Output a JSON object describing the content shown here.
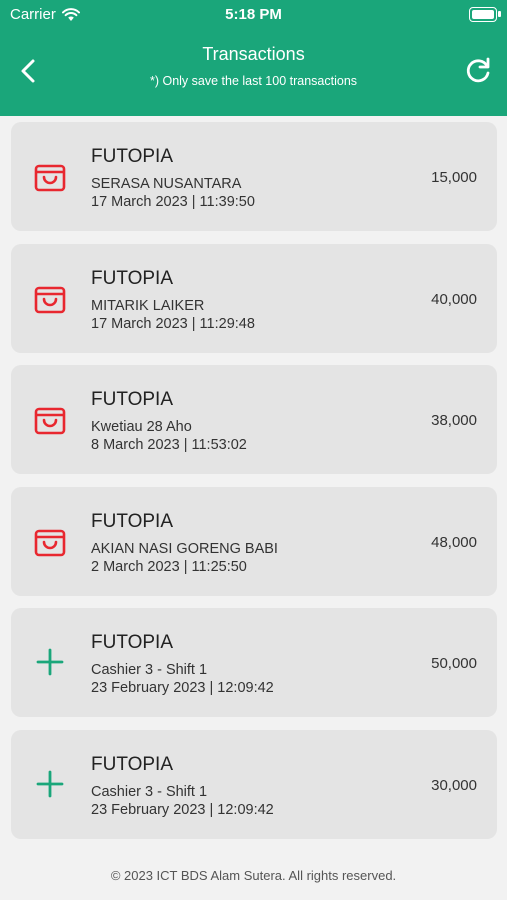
{
  "status_bar": {
    "carrier": "Carrier",
    "time": "5:18 PM"
  },
  "nav": {
    "title": "Transactions",
    "subtitle": "*) Only save the last 100 transactions",
    "back_icon": "chevron-left-icon",
    "refresh_icon": "refresh-icon"
  },
  "colors": {
    "header": "#1aa67a",
    "purchase_icon": "#e8272f",
    "topup_icon": "#1aa67a",
    "card": "#e4e4e4"
  },
  "transactions": [
    {
      "type": "purchase",
      "icon": "shopping-bag-icon",
      "merchant": "FUTOPIA",
      "description": "SERASA NUSANTARA",
      "datetime": "17 March 2023 | 11:39:50",
      "amount": "15,000"
    },
    {
      "type": "purchase",
      "icon": "shopping-bag-icon",
      "merchant": "FUTOPIA",
      "description": "MITARIK LAIKER",
      "datetime": "17 March 2023 | 11:29:48",
      "amount": "40,000"
    },
    {
      "type": "purchase",
      "icon": "shopping-bag-icon",
      "merchant": "FUTOPIA",
      "description": "Kwetiau 28 Aho",
      "datetime": "8 March 2023 | 11:53:02",
      "amount": "38,000"
    },
    {
      "type": "purchase",
      "icon": "shopping-bag-icon",
      "merchant": "FUTOPIA",
      "description": "AKIAN NASI GORENG BABI",
      "datetime": "2 March 2023 | 11:25:50",
      "amount": "48,000"
    },
    {
      "type": "topup",
      "icon": "plus-icon",
      "merchant": "FUTOPIA",
      "description": "Cashier 3 - Shift 1",
      "datetime": "23 February 2023 | 12:09:42",
      "amount": "50,000"
    },
    {
      "type": "topup",
      "icon": "plus-icon",
      "merchant": "FUTOPIA",
      "description": "Cashier 3 - Shift 1",
      "datetime": "23 February 2023 | 12:09:42",
      "amount": "30,000"
    }
  ],
  "footer": {
    "text": "© 2023 ICT BDS Alam Sutera. All rights reserved."
  }
}
